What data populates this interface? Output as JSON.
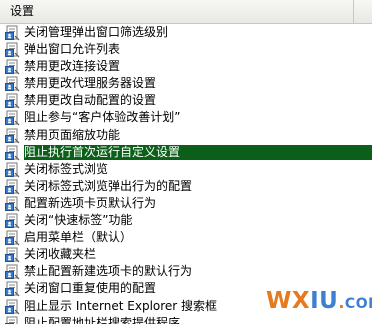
{
  "header": {
    "column_label": "设置"
  },
  "policies": [
    {
      "label": "关闭管理弹出窗口筛选级别",
      "icon": "policy-setting-icon",
      "selected": false
    },
    {
      "label": "弹出窗口允许列表",
      "icon": "policy-setting-icon",
      "selected": false
    },
    {
      "label": "禁用更改连接设置",
      "icon": "policy-setting-icon",
      "selected": false
    },
    {
      "label": "禁用更改代理服务器设置",
      "icon": "policy-setting-icon",
      "selected": false
    },
    {
      "label": "禁用更改自动配置的设置",
      "icon": "policy-setting-icon",
      "selected": false
    },
    {
      "label": "阻止参与“客户体验改善计划”",
      "icon": "policy-setting-icon",
      "selected": false
    },
    {
      "label": "禁用页面缩放功能",
      "icon": "policy-setting-icon",
      "selected": false
    },
    {
      "label": "阻止执行首次运行自定义设置",
      "icon": "policy-setting-icon",
      "selected": true
    },
    {
      "label": "关闭标签式浏览",
      "icon": "policy-setting-icon",
      "selected": false
    },
    {
      "label": "关闭标签式浏览弹出行为的配置",
      "icon": "policy-setting-icon",
      "selected": false
    },
    {
      "label": "配置新选项卡页默认行为",
      "icon": "policy-setting-icon",
      "selected": false
    },
    {
      "label": "关闭“快速标签”功能",
      "icon": "policy-setting-icon",
      "selected": false
    },
    {
      "label": "启用菜单栏（默认）",
      "icon": "policy-setting-icon",
      "selected": false
    },
    {
      "label": "关闭收藏夹栏",
      "icon": "policy-setting-icon",
      "selected": false
    },
    {
      "label": "禁止配置新建选项卡的默认行为",
      "icon": "policy-setting-icon",
      "selected": false
    },
    {
      "label": "关闭窗口重复使用的配置",
      "icon": "policy-setting-icon",
      "selected": false
    },
    {
      "label": "阻止显示 Internet Explorer 搜索框",
      "icon": "policy-setting-icon",
      "selected": false
    },
    {
      "label": "阻止配置地址栏搜索提供程序",
      "icon": "policy-setting-icon",
      "selected": false
    }
  ],
  "watermark": {
    "part1": "WX",
    "part2": "IU",
    "dot": ".",
    "suffix": "COM"
  },
  "colors": {
    "selection": "#0c5f19",
    "watermark_orange": "#e57a1f",
    "watermark_blue": "#3e7fd0"
  }
}
